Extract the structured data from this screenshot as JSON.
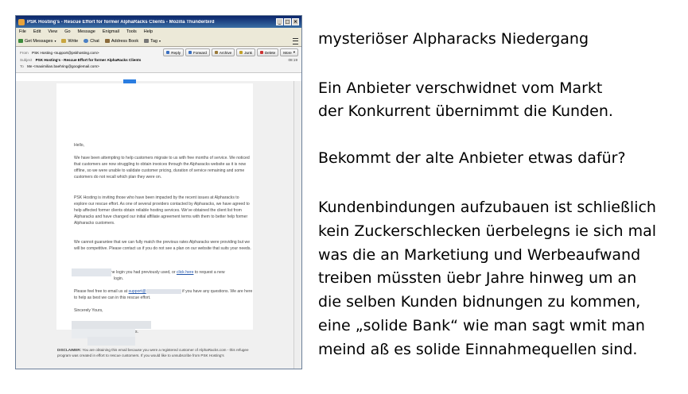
{
  "window": {
    "title": "PSK Hosting's - Rescue Effort for former AlphaRacks Clients - Mozilla Thunderbird",
    "controls": [
      "_",
      "□",
      "×"
    ]
  },
  "menubar": [
    "File",
    "Edit",
    "View",
    "Go",
    "Message",
    "Enigmail",
    "Tools",
    "Help"
  ],
  "toolbar": {
    "get_messages": "Get Messages",
    "write": "Write",
    "chat": "Chat",
    "address_book": "Address Book",
    "tag": "Tag"
  },
  "message_actions": [
    "Reply",
    "Forward",
    "Archive",
    "Junk",
    "Delete",
    "More"
  ],
  "header": {
    "from_label": "From",
    "from": "PSK Hosting <support@pskhosting.com>",
    "subject_label": "Subject",
    "subject": "PSK Hosting's - Rescue Effort for former AlphaRacks Clients",
    "to_label": "To",
    "to": "Me <maximilian.baehring@googlemail.com>",
    "time": "08:19"
  },
  "email": {
    "greeting": "Hello,",
    "para1": "We have been attempting to help customers migrate to us with free months of service. We noticed that customers are now struggling to obtain invoices through the Alpharacks website as it is now offline, so we were unable to validate customer pricing, duration of service remaining and some customers do not recall which plan they were on.",
    "para2": "PSK Hosting is inviting those who have been impacted by the recent issues at Alpharacks to explore our rescue effort. As one of several providers contacted by Alpharacks, we have agreed to help affected former clients obtain reliable hosting services. We've obtained the client list from Alpharacks and have changed our initial affiliate agreement terms with them to better help former Alpharacks customers.",
    "para3": "We cannot guarantee that we can fully match the previous rates Alpharacks were providing but we will be competitive. Please contact us if you do not see a plan on our website that suits your needs.",
    "para4_pre": "You may use the same login you had previously used, or ",
    "para4_link": "click here",
    "para4_post": " to request a new",
    "para4_line2": "login.",
    "para5_pre": "Please feel free to email us at ",
    "para5_link": "support@",
    "para5_post": " if you have any questions. We are here to help as best we can in this rescue effort.",
    "closing": "Sincerely Yours,",
    "separator": "===========",
    "sign_suffix": "s.",
    "disclaimer_label": "DISCLAIMER:",
    "disclaimer": " You are obtaining this email because you were a registered customer of AlphaRacks.com - this refugee program was created in effort to rescue customers. If you would like to unsubscribe from PSK Hosting's"
  },
  "notes": {
    "title": "mysteriöser Alpharacks Niedergang",
    "block1": [
      "Ein Anbieter verschwidnet vom Markt",
      "der Konkurrent übernimmt die Kunden."
    ],
    "block2": "Bekommt der alte Anbieter etwas dafür?",
    "block3": [
      "Kundenbindungen aufzubauen ist schließlich",
      "kein Zuckerschlecken üerbelegns ie sich mal",
      "was die an Marketiung und Werbeaufwand",
      "treiben müssten üebr Jahre hinweg um an",
      "die selben Kunden bidnungen zu kommen,",
      "eine „solide Bank“ wie man sagt wmit man",
      "meind aß es solide Einnahmequellen sind."
    ]
  },
  "colors": {
    "titlebar": "#0a246a",
    "link": "#2255aa",
    "logo_blue": "#2a7de1"
  }
}
